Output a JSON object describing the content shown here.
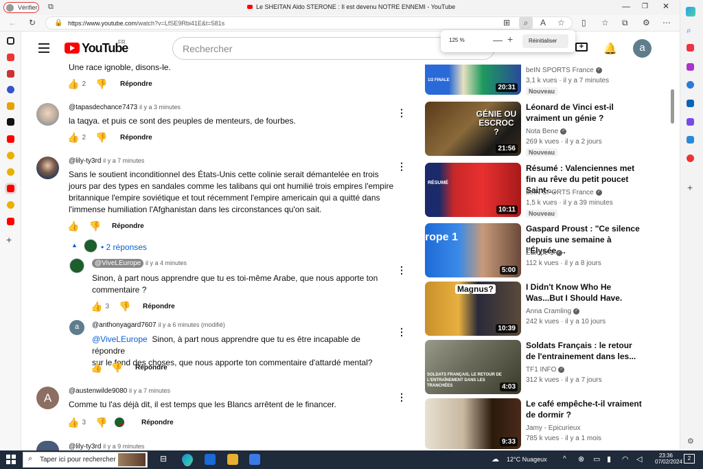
{
  "browser": {
    "verify_label": "Vérifier",
    "tab_title": "Le SHEITAN Aldo STERONE : Il est devenu NOTRE ENNEMI - YouTube",
    "url_host": "https://www.youtube.com",
    "url_path": "/watch?v=LfSE9Rbi41E&t=581s",
    "zoom_percent": "125 %",
    "zoom_minus": "—",
    "zoom_plus": "+",
    "zoom_reset": "Réinitialiser"
  },
  "youtube": {
    "logo_text": "YouTube",
    "country": "FR",
    "search_placeholder": "Rechercher",
    "user_initial": "a"
  },
  "comments": [
    {
      "text": "Une race ignoble, disons-le.",
      "likes": "2",
      "reply_label": "Répondre"
    },
    {
      "author": "@tapasdechance7473",
      "time": "il y a 3 minutes",
      "text": "la taqya. et puis ce sont des peuples de menteurs, de fourbes.",
      "likes": "2",
      "reply_label": "Répondre"
    },
    {
      "author": "@lily-ty3rd",
      "time": "il y a 7 minutes",
      "text_lines": [
        "Sans le soutient inconditionnel des États-Unis cette colinie serait démantelée en trois",
        "jours par des types en sandales comme les talibans qui ont humilié trois empires l'empire",
        "britannique l'empire soviétique et tout récemment l'empire americain qui a quitté dans",
        "l'immense humiliation l'Afghanistan dans les circonstances qu'on sait."
      ],
      "reply_label": "Répondre",
      "replies_label": "2 réponses"
    },
    {
      "author": "@austenwilde9080",
      "time": "il y a 7 minutes",
      "avatar_letter": "A",
      "text": "Comme tu l'as déjà dit, il est temps que les Blancs arrêtent de le financer.",
      "likes": "3",
      "reply_label": "Répondre"
    },
    {
      "author": "@lily-ty3rd",
      "time": "il y a 9 minutes"
    }
  ],
  "replies": [
    {
      "author": "@ViveLEurope",
      "time": "il y a 4 minutes",
      "text_lines": [
        "Sinon, à part nous apprendre que tu es toi-même Arabe, que nous apporte ton",
        "commentaire ?"
      ],
      "likes": "3",
      "reply_label": "Répondre"
    },
    {
      "author": "@anthonyagard7607",
      "time": "il y a 6 minutes (modifié)",
      "avatar_letter": "a",
      "mention": "@ViveLEurope",
      "text_line1": "Sinon, à part nous apprendre que tu es être incapable de répondre",
      "text_line2": "sur le fond des choses, que nous apporte ton commentaire d'attardé mental?",
      "reply_label": "Répondre"
    }
  ],
  "videos": [
    {
      "title": "",
      "channel": "beIN SPORTS France",
      "meta": "3,1 k vues · il y a 7 minutes",
      "badge": "Nouveau",
      "duration": "20:31",
      "thumb_text": "1/2 FINALE"
    },
    {
      "title": "Léonard de Vinci est-il vraiment un génie ?",
      "channel": "Nota Bene",
      "meta": "269 k vues · il y a 2 jours",
      "badge": "Nouveau",
      "duration": "21:56",
      "thumb_text": "GÉNIE OU ESCROC ?"
    },
    {
      "title": "Résumé : Valenciennes met fin au rêve du petit poucet Saint-...",
      "channel": "beIN SPORTS France",
      "meta": "1,5 k vues · il y a 39 minutes",
      "badge": "Nouveau",
      "duration": "10:11",
      "thumb_text": "RÉSUMÉ"
    },
    {
      "title": "Gaspard Proust : \"Ce silence depuis une semaine à l'Élysée,...",
      "channel": "Europe 1",
      "meta": "112 k vues · il y a 8 jours",
      "duration": "5:00",
      "thumb_text": "rope 1"
    },
    {
      "title": "I Didn't Know Who He Was...But I Should Have.",
      "channel": "Anna Cramling",
      "meta": "242 k vues · il y a 10 jours",
      "duration": "10:39",
      "thumb_text": "Magnus?"
    },
    {
      "title": "Soldats Français : le retour de l'entrainement dans les...",
      "channel": "TF1 INFO",
      "meta": "312 k vues · il y a 7 jours",
      "duration": "4:03",
      "thumb_text": "SOLDATS FRANÇAIS, LE RETOUR DE L'ENTRAÎNEMENT DANS LES TRANCHÉES"
    },
    {
      "title": "Le café empêche-t-il vraiment de dormir ?",
      "channel": "Jamy - Epicurieux",
      "meta": "785 k vues · il y a 1 mois",
      "duration": "9:33"
    }
  ],
  "taskbar": {
    "search_placeholder": "Taper ici pour rechercher",
    "weather": "12°C  Nuageux",
    "time": "23:36",
    "date": "07/02/2024",
    "notif_count": "2"
  },
  "colors": {
    "accent": "#065fd4",
    "youtube_red": "#ff0000",
    "taskbar": "#1f2a3a"
  }
}
